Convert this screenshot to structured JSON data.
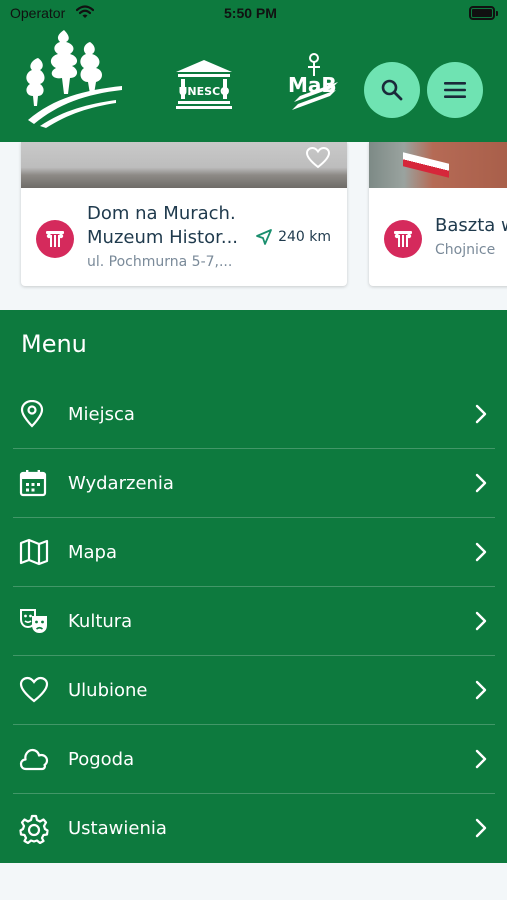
{
  "status_bar": {
    "carrier": "Operator",
    "time": "5:50 PM"
  },
  "header": {
    "logos": [
      "forest-logo",
      "unesco-logo",
      "mab-logo"
    ],
    "unesco_text": "UNESCO",
    "mab_text": "MaB",
    "search_icon": "search-icon",
    "menu_icon": "hamburger-icon",
    "accent": "#6fe3b2",
    "background": "#0d7a3e"
  },
  "cards": [
    {
      "title_line1": "Dom na Murach.",
      "title_line2": "Muzeum Histor...",
      "address": "ul. Pochmurna 5-7,...",
      "distance": "240 km",
      "category_icon": "museum-icon",
      "favorite_icon": "heart-icon"
    },
    {
      "title_line1": "Baszta w",
      "address": "Chojnice",
      "category_icon": "museum-icon"
    }
  ],
  "menu": {
    "title": "Menu",
    "items": [
      {
        "label": "Miejsca",
        "icon": "map-pin-icon"
      },
      {
        "label": "Wydarzenia",
        "icon": "calendar-icon"
      },
      {
        "label": "Mapa",
        "icon": "map-icon"
      },
      {
        "label": "Kultura",
        "icon": "theater-masks-icon"
      },
      {
        "label": "Ulubione",
        "icon": "heart-icon"
      },
      {
        "label": "Pogoda",
        "icon": "cloud-icon"
      },
      {
        "label": "Ustawienia",
        "icon": "gear-icon"
      }
    ]
  },
  "colors": {
    "brand_green": "#0d7a3e",
    "category_pink": "#d52a5c",
    "accent_mint": "#6fe3b2"
  }
}
